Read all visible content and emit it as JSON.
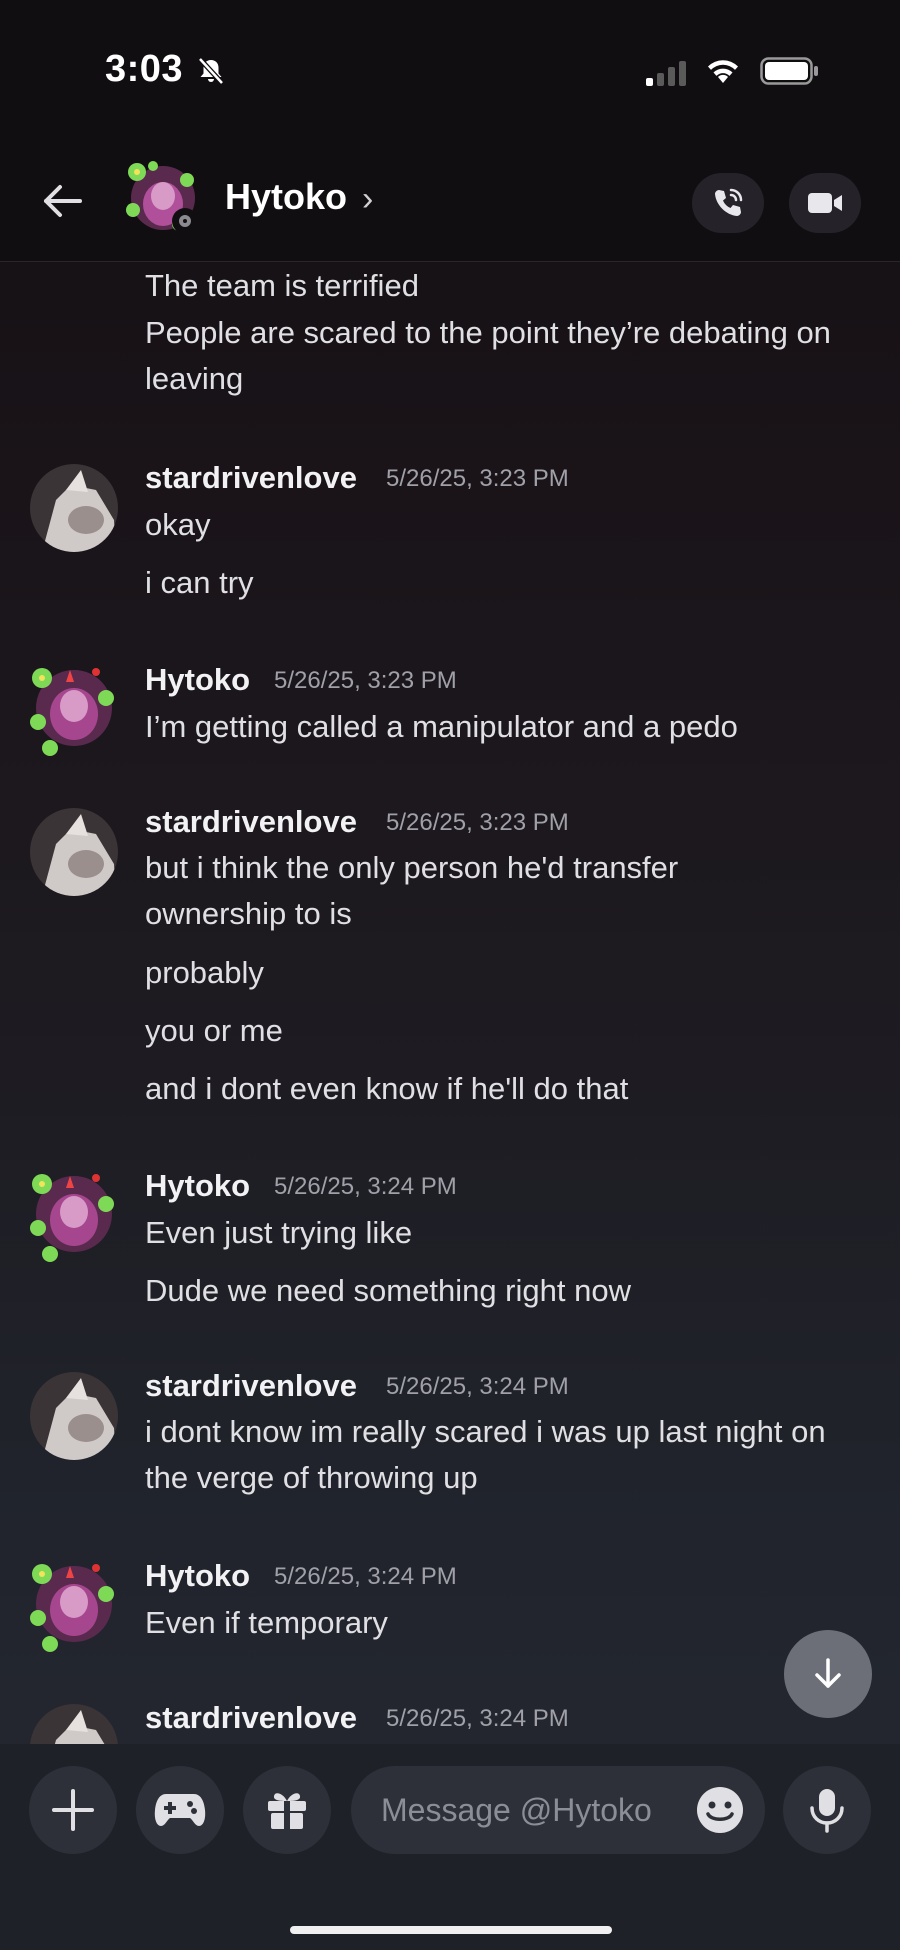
{
  "status_bar": {
    "time": "3:03"
  },
  "header": {
    "name": "Hytoko",
    "chevron": "›"
  },
  "messages": [
    {
      "type": "cont",
      "text": "The team is terrified"
    },
    {
      "type": "cont",
      "text": "People are scared to the point they’re debating on leaving"
    },
    {
      "type": "group",
      "author": "stardrivenlove",
      "time": "5/26/25, 3:23 PM",
      "lines": [
        "okay",
        "i can try"
      ]
    },
    {
      "type": "group",
      "author": "Hytoko",
      "time": "5/26/25, 3:23 PM",
      "lines": [
        "I’m getting called a manipulator and a pedo"
      ]
    },
    {
      "type": "group",
      "author": "stardrivenlove",
      "time": "5/26/25, 3:23 PM",
      "lines": [
        "but i think the only person he'd transfer ownership to is",
        "probably",
        "you or me",
        "and i dont even know if he'll do that"
      ]
    },
    {
      "type": "group",
      "author": "Hytoko",
      "time": "5/26/25, 3:24 PM",
      "lines": [
        "Even just trying like",
        "Dude we need something right now"
      ]
    },
    {
      "type": "group",
      "author": "stardrivenlove",
      "time": "5/26/25, 3:24 PM",
      "lines": [
        "i dont know im really scared i was up last night on the verge of throwing up"
      ]
    },
    {
      "type": "group",
      "author": "Hytoko",
      "time": "5/26/25, 3:24 PM",
      "lines": [
        "Even if temporary"
      ]
    },
    {
      "type": "group",
      "author": "stardrivenlove",
      "time": "5/26/25, 3:24 PM",
      "lines": []
    }
  ],
  "composer": {
    "placeholder": "Message @Hytoko"
  }
}
